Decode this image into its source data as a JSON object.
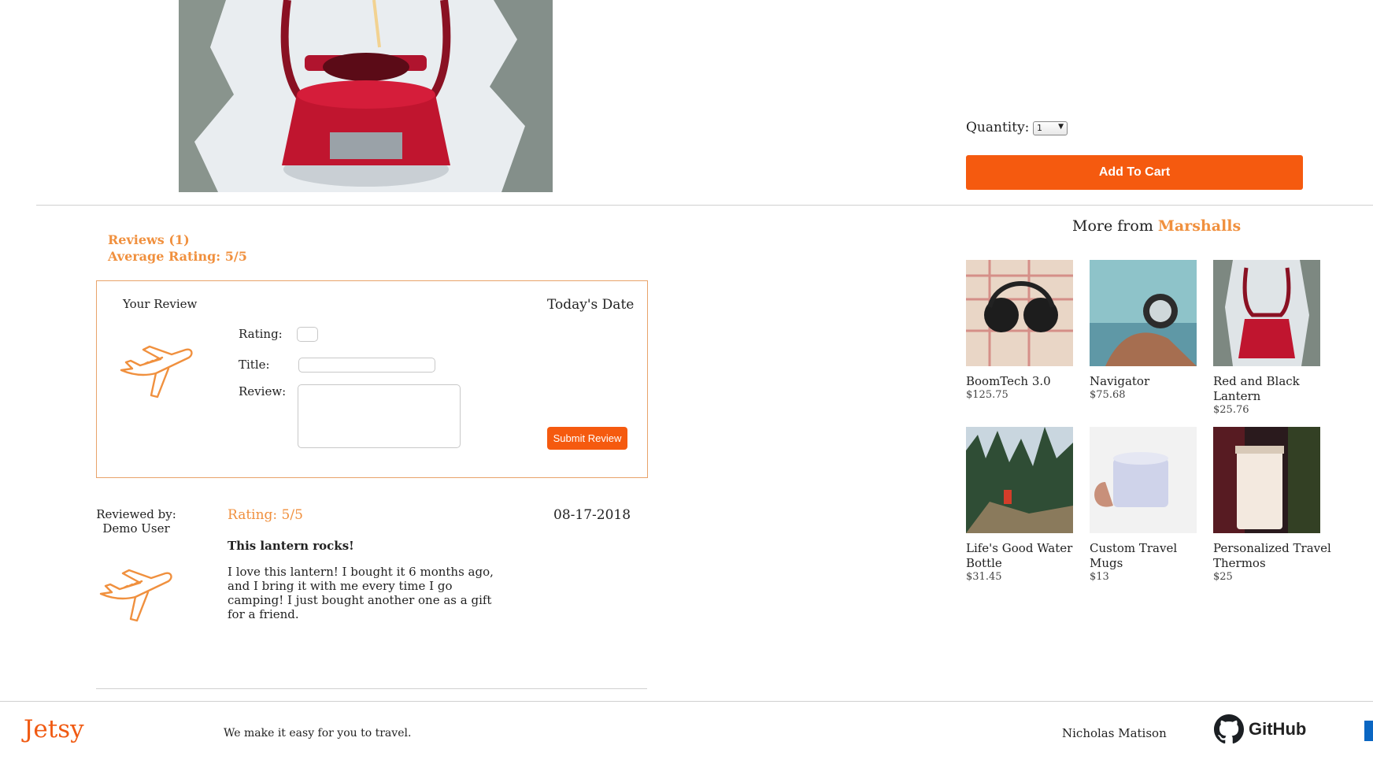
{
  "product": {
    "image_alt": "red lantern in snow",
    "quantity_label": "Quantity:",
    "quantity_value": "1",
    "add_to_cart": "Add To Cart"
  },
  "reviews": {
    "count_label": "Reviews (1)",
    "average_label": "Average Rating: 5/5",
    "form": {
      "your_review": "Your Review",
      "date_label": "Today's Date",
      "rating_label": "Rating:",
      "title_label": "Title:",
      "review_label": "Review:",
      "submit": "Submit Review"
    },
    "items": [
      {
        "reviewed_by": "Reviewed by:",
        "user": "Demo User",
        "rating": "Rating: 5/5",
        "date": "08-17-2018",
        "title": "This lantern rocks!",
        "body": "I love this lantern! I bought it 6 months ago, and I bring it with me every time I go camping! I just bought another one as a gift for a friend."
      }
    ]
  },
  "more_from": {
    "label": "More from",
    "shop": "Marshalls",
    "items": [
      {
        "name": "BoomTech 3.0",
        "price": "$125.75"
      },
      {
        "name": "Navigator",
        "price": "$75.68"
      },
      {
        "name": "Red and Black Lantern",
        "price": "$25.76"
      },
      {
        "name": "Life's Good Water Bottle",
        "price": "$31.45"
      },
      {
        "name": "Custom Travel Mugs",
        "price": "$13"
      },
      {
        "name": "Personalized Travel Thermos",
        "price": "$25"
      }
    ]
  },
  "footer": {
    "logo": "Jetsy",
    "tagline": "We make it easy for you to travel.",
    "author": "Nicholas Matison",
    "github": "GitHub"
  },
  "colors": {
    "accent": "#f55a0f",
    "accent_text": "#f0903e",
    "brand": "#f05a12"
  }
}
